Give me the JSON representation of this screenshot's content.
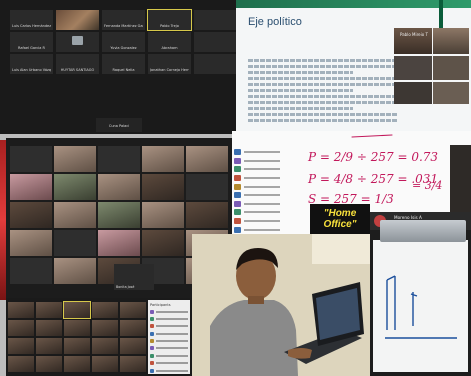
{
  "zoom_top_left": {
    "tiles": [
      {
        "name": "Luis Carlos Hernández Gómez",
        "cam": false,
        "active": false
      },
      {
        "name": "",
        "cam": true,
        "active": false
      },
      {
        "name": "Fernanda Martínez García",
        "cam": false,
        "active": false
      },
      {
        "name": "Pablo Trejo",
        "cam": false,
        "active": true
      },
      {
        "name": "",
        "cam": false,
        "active": false
      },
      {
        "name": "Rafael Garcia R",
        "cam": false,
        "active": false
      },
      {
        "name": "",
        "cam": false,
        "active": false,
        "mini": true
      },
      {
        "name": "Yuvia Gonzalez",
        "cam": false,
        "active": false
      },
      {
        "name": "Abraham",
        "cam": false,
        "active": false
      },
      {
        "name": "",
        "cam": false,
        "active": false
      },
      {
        "name": "Luis Alan Urbano Vázquez",
        "cam": false,
        "active": false
      },
      {
        "name": "HUYTAR SANTIAGO",
        "cam": false,
        "active": false
      },
      {
        "name": "Raquel Nelia",
        "cam": false,
        "active": false
      },
      {
        "name": "Jonathan Cornejo Hernández",
        "cam": false,
        "active": false
      },
      {
        "name": "",
        "cam": false,
        "active": false
      }
    ],
    "bottom_label": "Cuna Palaci"
  },
  "slide": {
    "title": "Eje político",
    "labels": [
      "Pablo Mireio T",
      "",
      "",
      "",
      "",
      ""
    ]
  },
  "zoom_middle": {
    "tiles": [
      "",
      "",
      "",
      "",
      "",
      "",
      "",
      "",
      "",
      "",
      "",
      "",
      "",
      "",
      "",
      "",
      "",
      "",
      "",
      "",
      "",
      "",
      "",
      "",
      ""
    ],
    "bottom_label": "Bonita José"
  },
  "participants_panel": {
    "title": "Participants"
  },
  "math": {
    "lines": [
      "P = 2/9 ÷ 257 = 0.73",
      "P = 4/8 ÷ 257 = .031",
      "S = 257 = 1/3",
      "= 3/4"
    ],
    "banner_line1": "\"Home",
    "banner_line2": "Office\""
  },
  "phone": {
    "title": "Moreno Isis A",
    "subtitle": "Estás compartiendo"
  },
  "colors": {
    "zoom_bg": "#1a1a1a",
    "active_border": "#d6c84a",
    "slide_accent": "#1f6f4d",
    "banner_text": "#f7e03c"
  }
}
